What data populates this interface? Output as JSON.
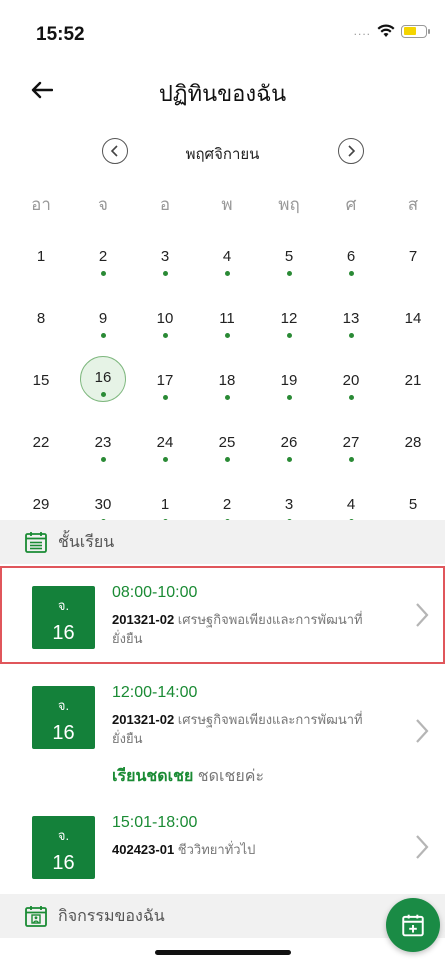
{
  "status_bar": {
    "time": "15:52",
    "signal": "....",
    "wifi_icon": "wifi-icon",
    "battery_icon": "battery-icon"
  },
  "header": {
    "title": "ปฏิทินของฉัน",
    "back_icon": "arrow-left-icon"
  },
  "calendar": {
    "month": "พฤศจิกายน",
    "weekdays": [
      "อา",
      "จ",
      "อ",
      "พ",
      "พฤ",
      "ศ",
      "ส"
    ],
    "weeks": [
      [
        {
          "day": "1",
          "dot": false
        },
        {
          "day": "2",
          "dot": true
        },
        {
          "day": "3",
          "dot": true
        },
        {
          "day": "4",
          "dot": true
        },
        {
          "day": "5",
          "dot": true
        },
        {
          "day": "6",
          "dot": true
        },
        {
          "day": "7",
          "dot": false
        }
      ],
      [
        {
          "day": "8",
          "dot": false
        },
        {
          "day": "9",
          "dot": true
        },
        {
          "day": "10",
          "dot": true
        },
        {
          "day": "11",
          "dot": true
        },
        {
          "day": "12",
          "dot": true
        },
        {
          "day": "13",
          "dot": true
        },
        {
          "day": "14",
          "dot": false
        }
      ],
      [
        {
          "day": "15",
          "dot": false
        },
        {
          "day": "16",
          "dot": true,
          "selected": true
        },
        {
          "day": "17",
          "dot": true
        },
        {
          "day": "18",
          "dot": true
        },
        {
          "day": "19",
          "dot": true
        },
        {
          "day": "20",
          "dot": true
        },
        {
          "day": "21",
          "dot": false
        }
      ],
      [
        {
          "day": "22",
          "dot": false
        },
        {
          "day": "23",
          "dot": true
        },
        {
          "day": "24",
          "dot": true
        },
        {
          "day": "25",
          "dot": true
        },
        {
          "day": "26",
          "dot": true
        },
        {
          "day": "27",
          "dot": true
        },
        {
          "day": "28",
          "dot": false
        }
      ],
      [
        {
          "day": "29",
          "dot": false
        },
        {
          "day": "30",
          "dot": true
        },
        {
          "day": "1",
          "dot": true
        },
        {
          "day": "2",
          "dot": true
        },
        {
          "day": "3",
          "dot": true
        },
        {
          "day": "4",
          "dot": true
        },
        {
          "day": "5",
          "dot": false
        }
      ]
    ]
  },
  "classes_section": {
    "label": "ชั้นเรียน",
    "icon": "calendar-list-icon"
  },
  "classes": [
    {
      "dow": "จ.",
      "date": "16",
      "time": "08:00-10:00",
      "code": "201321-02",
      "name": "เศรษฐกิจพอเพียงและการพัฒนาที่ยั่งยืน"
    },
    {
      "dow": "จ.",
      "date": "16",
      "time": "12:00-14:00",
      "code": "201321-02",
      "name": "เศรษฐกิจพอเพียงและการพัฒนาที่ยั่งยืน",
      "makeup_label": "เรียนชดเชย",
      "makeup_note": "ชดเชยค่ะ"
    },
    {
      "dow": "จ.",
      "date": "16",
      "time": "15:01-18:00",
      "code": "402423-01",
      "name": "ชีววิทยาทั่วไป"
    }
  ],
  "activities_section": {
    "label": "กิจกรรมของฉัน",
    "icon": "calendar-person-icon"
  },
  "fab": {
    "icon": "calendar-add-icon"
  },
  "colors": {
    "accent": "#14813a",
    "highlight_border": "#e0565b",
    "section_bg": "#f1f1f1"
  }
}
